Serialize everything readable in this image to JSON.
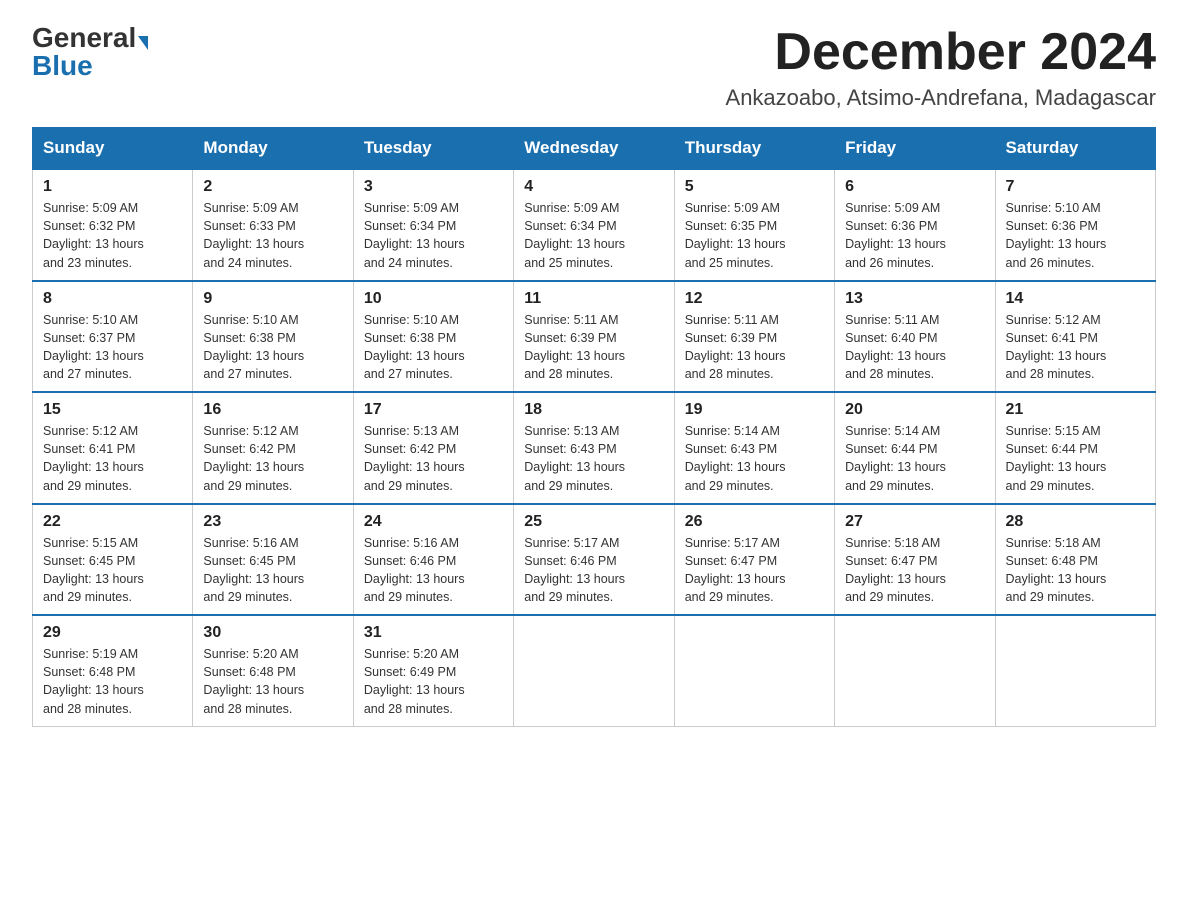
{
  "logo": {
    "general": "General",
    "blue": "Blue"
  },
  "header": {
    "month": "December 2024",
    "location": "Ankazoabo, Atsimo-Andrefana, Madagascar"
  },
  "days_of_week": [
    "Sunday",
    "Monday",
    "Tuesday",
    "Wednesday",
    "Thursday",
    "Friday",
    "Saturday"
  ],
  "weeks": [
    [
      {
        "day": "1",
        "sunrise": "5:09 AM",
        "sunset": "6:32 PM",
        "daylight": "13 hours and 23 minutes."
      },
      {
        "day": "2",
        "sunrise": "5:09 AM",
        "sunset": "6:33 PM",
        "daylight": "13 hours and 24 minutes."
      },
      {
        "day": "3",
        "sunrise": "5:09 AM",
        "sunset": "6:34 PM",
        "daylight": "13 hours and 24 minutes."
      },
      {
        "day": "4",
        "sunrise": "5:09 AM",
        "sunset": "6:34 PM",
        "daylight": "13 hours and 25 minutes."
      },
      {
        "day": "5",
        "sunrise": "5:09 AM",
        "sunset": "6:35 PM",
        "daylight": "13 hours and 25 minutes."
      },
      {
        "day": "6",
        "sunrise": "5:09 AM",
        "sunset": "6:36 PM",
        "daylight": "13 hours and 26 minutes."
      },
      {
        "day": "7",
        "sunrise": "5:10 AM",
        "sunset": "6:36 PM",
        "daylight": "13 hours and 26 minutes."
      }
    ],
    [
      {
        "day": "8",
        "sunrise": "5:10 AM",
        "sunset": "6:37 PM",
        "daylight": "13 hours and 27 minutes."
      },
      {
        "day": "9",
        "sunrise": "5:10 AM",
        "sunset": "6:38 PM",
        "daylight": "13 hours and 27 minutes."
      },
      {
        "day": "10",
        "sunrise": "5:10 AM",
        "sunset": "6:38 PM",
        "daylight": "13 hours and 27 minutes."
      },
      {
        "day": "11",
        "sunrise": "5:11 AM",
        "sunset": "6:39 PM",
        "daylight": "13 hours and 28 minutes."
      },
      {
        "day": "12",
        "sunrise": "5:11 AM",
        "sunset": "6:39 PM",
        "daylight": "13 hours and 28 minutes."
      },
      {
        "day": "13",
        "sunrise": "5:11 AM",
        "sunset": "6:40 PM",
        "daylight": "13 hours and 28 minutes."
      },
      {
        "day": "14",
        "sunrise": "5:12 AM",
        "sunset": "6:41 PM",
        "daylight": "13 hours and 28 minutes."
      }
    ],
    [
      {
        "day": "15",
        "sunrise": "5:12 AM",
        "sunset": "6:41 PM",
        "daylight": "13 hours and 29 minutes."
      },
      {
        "day": "16",
        "sunrise": "5:12 AM",
        "sunset": "6:42 PM",
        "daylight": "13 hours and 29 minutes."
      },
      {
        "day": "17",
        "sunrise": "5:13 AM",
        "sunset": "6:42 PM",
        "daylight": "13 hours and 29 minutes."
      },
      {
        "day": "18",
        "sunrise": "5:13 AM",
        "sunset": "6:43 PM",
        "daylight": "13 hours and 29 minutes."
      },
      {
        "day": "19",
        "sunrise": "5:14 AM",
        "sunset": "6:43 PM",
        "daylight": "13 hours and 29 minutes."
      },
      {
        "day": "20",
        "sunrise": "5:14 AM",
        "sunset": "6:44 PM",
        "daylight": "13 hours and 29 minutes."
      },
      {
        "day": "21",
        "sunrise": "5:15 AM",
        "sunset": "6:44 PM",
        "daylight": "13 hours and 29 minutes."
      }
    ],
    [
      {
        "day": "22",
        "sunrise": "5:15 AM",
        "sunset": "6:45 PM",
        "daylight": "13 hours and 29 minutes."
      },
      {
        "day": "23",
        "sunrise": "5:16 AM",
        "sunset": "6:45 PM",
        "daylight": "13 hours and 29 minutes."
      },
      {
        "day": "24",
        "sunrise": "5:16 AM",
        "sunset": "6:46 PM",
        "daylight": "13 hours and 29 minutes."
      },
      {
        "day": "25",
        "sunrise": "5:17 AM",
        "sunset": "6:46 PM",
        "daylight": "13 hours and 29 minutes."
      },
      {
        "day": "26",
        "sunrise": "5:17 AM",
        "sunset": "6:47 PM",
        "daylight": "13 hours and 29 minutes."
      },
      {
        "day": "27",
        "sunrise": "5:18 AM",
        "sunset": "6:47 PM",
        "daylight": "13 hours and 29 minutes."
      },
      {
        "day": "28",
        "sunrise": "5:18 AM",
        "sunset": "6:48 PM",
        "daylight": "13 hours and 29 minutes."
      }
    ],
    [
      {
        "day": "29",
        "sunrise": "5:19 AM",
        "sunset": "6:48 PM",
        "daylight": "13 hours and 28 minutes."
      },
      {
        "day": "30",
        "sunrise": "5:20 AM",
        "sunset": "6:48 PM",
        "daylight": "13 hours and 28 minutes."
      },
      {
        "day": "31",
        "sunrise": "5:20 AM",
        "sunset": "6:49 PM",
        "daylight": "13 hours and 28 minutes."
      },
      null,
      null,
      null,
      null
    ]
  ],
  "labels": {
    "sunrise": "Sunrise:",
    "sunset": "Sunset:",
    "daylight": "Daylight:"
  }
}
